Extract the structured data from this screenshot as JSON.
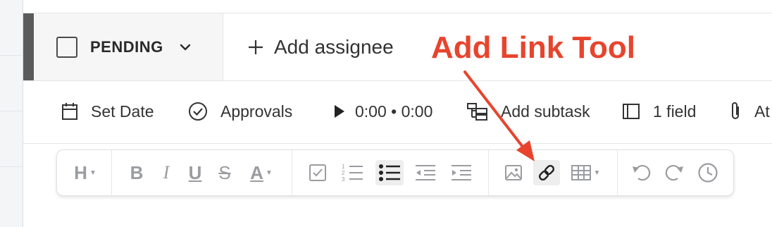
{
  "status": {
    "label": "PENDING"
  },
  "assignee": {
    "label": "Add assignee"
  },
  "annotation": {
    "text": "Add Link Tool",
    "color": "#e8442d"
  },
  "meta": {
    "set_date": "Set Date",
    "approvals": "Approvals",
    "timer": "0:00 • 0:00",
    "add_subtask": "Add subtask",
    "fields": "1 field",
    "attach": "At"
  },
  "toolbar": {
    "heading_glyph": "H",
    "bold_glyph": "B",
    "italic_glyph": "I",
    "underline_glyph": "U",
    "strike_glyph": "S",
    "text_color_glyph": "A",
    "active_tools": [
      "bulleted-list",
      "link"
    ]
  },
  "icons": [
    "checkbox-icon",
    "chevron-down-icon",
    "plus-icon",
    "calendar-icon",
    "check-circle-icon",
    "play-icon",
    "subtask-icon",
    "field-icon",
    "paperclip-icon",
    "checklist-icon",
    "numbered-list-icon",
    "bulleted-list-icon",
    "outdent-icon",
    "indent-icon",
    "image-icon",
    "link-icon",
    "table-icon",
    "undo-icon",
    "redo-icon",
    "history-icon"
  ]
}
